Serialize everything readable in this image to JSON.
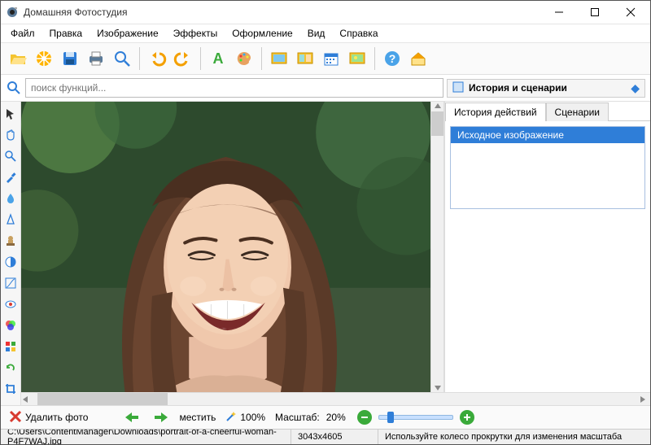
{
  "app": {
    "title": "Домашняя Фотостудия"
  },
  "menu": {
    "file": "Файл",
    "edit": "Правка",
    "image": "Изображение",
    "effects": "Эффекты",
    "decor": "Оформление",
    "view": "Вид",
    "help": "Справка"
  },
  "search": {
    "placeholder": "поиск функций..."
  },
  "panel": {
    "title": "История и сценарии",
    "tab_history": "История действий",
    "tab_scenarios": "Сценарии",
    "history_item0": "Исходное изображение"
  },
  "bottom": {
    "delete_photo": "Удалить фото",
    "fit": "местить",
    "percent_100": "100%",
    "scale_label": "Масштаб:",
    "scale_value": "20%"
  },
  "status": {
    "path": "C:\\Users\\ContentManager\\Downloads\\portrait-of-a-cheerful-woman-P4F7WAJ.jpg",
    "dims": "3043x4605",
    "hint": "Используйте колесо прокрутки для изменения масштаба"
  },
  "colors": {
    "accent": "#2f7ed8",
    "folder": "#f4c430",
    "green": "#3aaa3a",
    "red": "#d83a2f"
  }
}
